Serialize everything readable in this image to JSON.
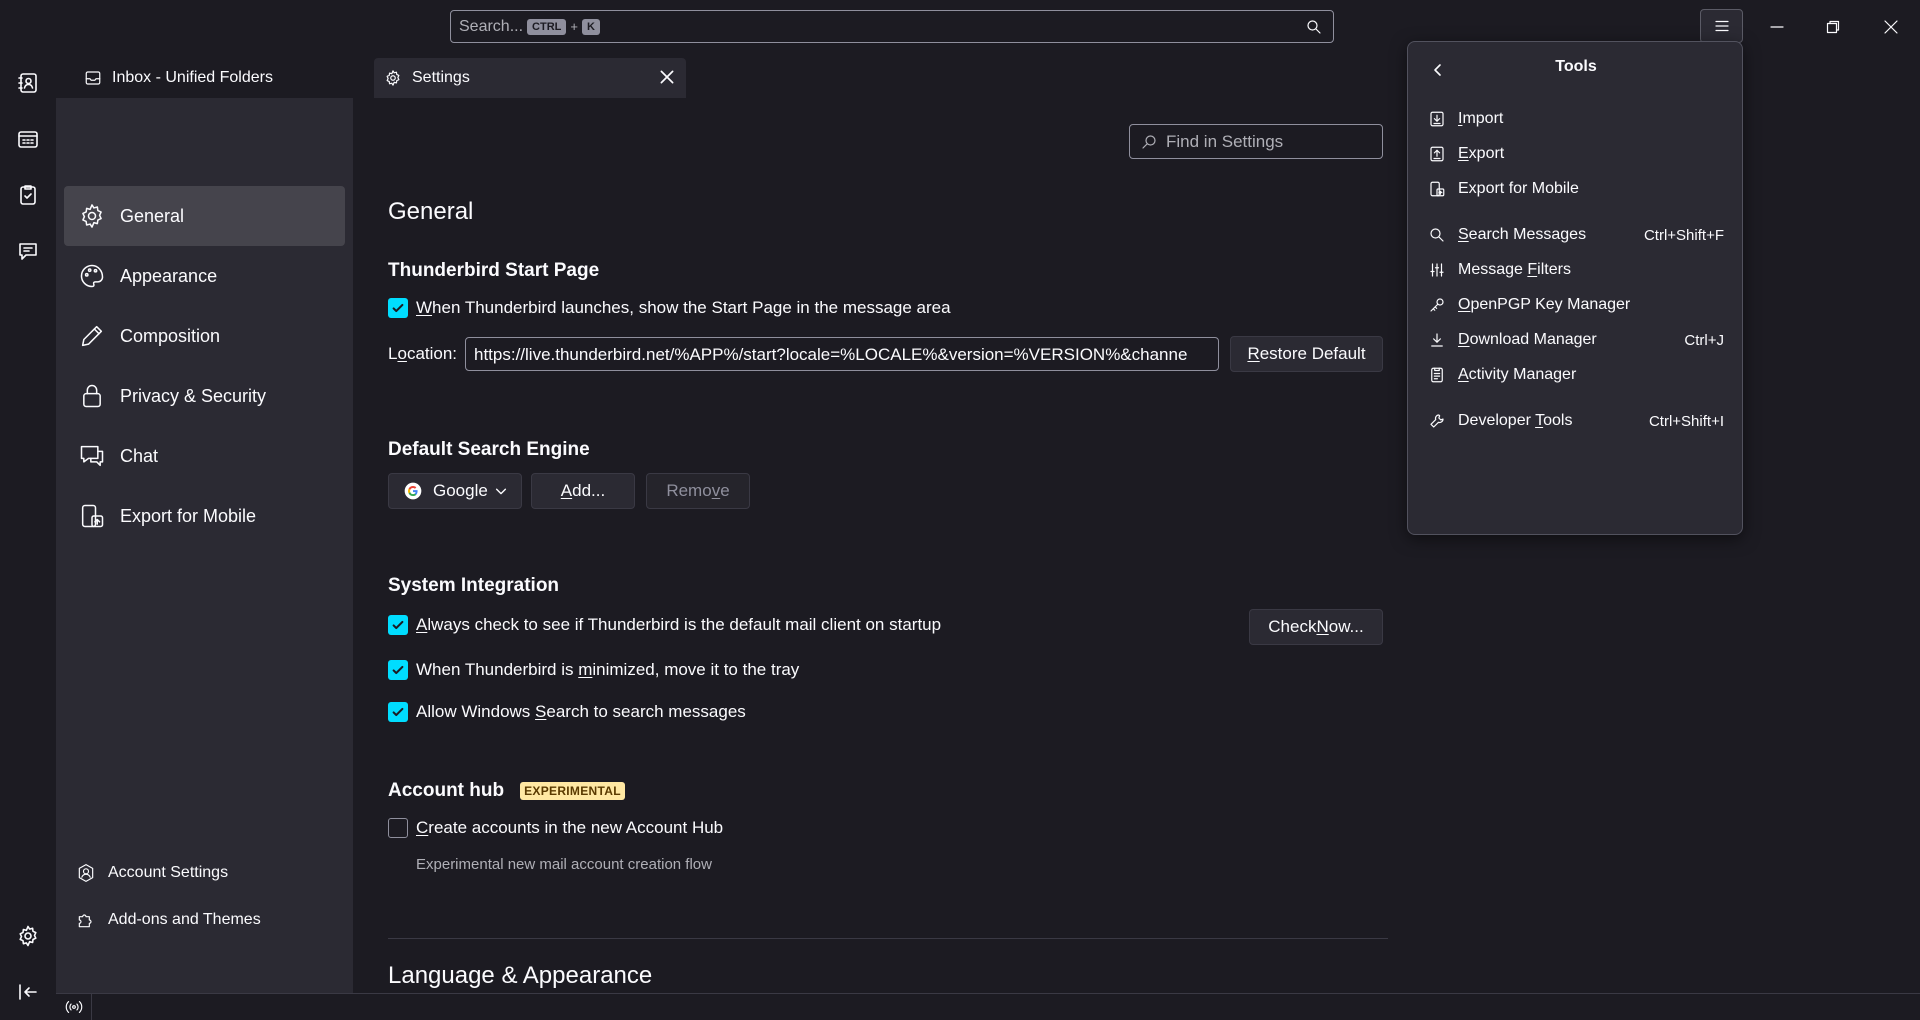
{
  "search": {
    "placeholder": "Search...",
    "kbd1": "CTRL",
    "plus": "+",
    "kbd2": "K"
  },
  "tabs": {
    "inbox": "Inbox - Unified Folders",
    "settings": "Settings"
  },
  "nav": {
    "items": [
      {
        "label": "General"
      },
      {
        "label": "Appearance"
      },
      {
        "label": "Composition"
      },
      {
        "label": "Privacy & Security"
      },
      {
        "label": "Chat"
      },
      {
        "label": "Export for Mobile"
      }
    ],
    "footer": [
      {
        "label": "Account Settings"
      },
      {
        "label": "Add-ons and Themes"
      }
    ]
  },
  "content": {
    "find_placeholder": "Find in Settings",
    "general_title": "General",
    "start_page": {
      "title": "Thunderbird Start Page",
      "checkbox_label_pre": "",
      "checkbox_label_u": "W",
      "checkbox_label_post": "hen Thunderbird launches, show the Start Page in the message area",
      "location_label_pre": "L",
      "location_label_u": "o",
      "location_label_post": "cation:",
      "location_value": "https://live.thunderbird.net/%APP%/start?locale=%LOCALE%&version=%VERSION%&channe",
      "restore_pre": "",
      "restore_u": "R",
      "restore_post": "estore Default"
    },
    "search_engine": {
      "title": "Default Search Engine",
      "selected": "Google",
      "add_pre": "",
      "add_u": "A",
      "add_post": "dd...",
      "remove_pre": "Remo",
      "remove_u": "v",
      "remove_post": "e"
    },
    "system": {
      "title": "System Integration",
      "check1_pre": "",
      "check1_u": "A",
      "check1_post": "lways check to see if Thunderbird is the default mail client on startup",
      "check_now_pre": "Check ",
      "check_now_u": "N",
      "check_now_post": "ow...",
      "check2_pre": "When Thunderbird is ",
      "check2_u": "m",
      "check2_post": "inimized, move it to the tray",
      "check3_pre": "Allow Windows ",
      "check3_u": "S",
      "check3_post": "earch to search messages"
    },
    "account_hub": {
      "title": "Account hub",
      "badge": "EXPERIMENTAL",
      "check_pre": "",
      "check_u": "C",
      "check_post": "reate accounts in the new Account Hub",
      "description": "Experimental new mail account creation flow"
    },
    "language_title": "Language & Appearance"
  },
  "tools": {
    "title": "Tools",
    "items": [
      {
        "pre": "",
        "u": "I",
        "post": "mport",
        "shortcut": ""
      },
      {
        "pre": "",
        "u": "E",
        "post": "xport",
        "shortcut": ""
      },
      {
        "pre": "Export for Mobile",
        "u": "",
        "post": "",
        "shortcut": ""
      },
      {
        "pre": "",
        "u": "S",
        "post": "earch Messages",
        "shortcut": "Ctrl+Shift+F"
      },
      {
        "pre": "Message ",
        "u": "F",
        "post": "ilters",
        "shortcut": ""
      },
      {
        "pre": "",
        "u": "O",
        "post": "penPGP Key Manager",
        "shortcut": ""
      },
      {
        "pre": "",
        "u": "D",
        "post": "ownload Manager",
        "shortcut": "Ctrl+J"
      },
      {
        "pre": "",
        "u": "A",
        "post": "ctivity Manager",
        "shortcut": ""
      },
      {
        "pre": "Developer ",
        "u": "T",
        "post": "ools",
        "shortcut": "Ctrl+Shift+I"
      }
    ]
  },
  "colors": {
    "accent": "#00ddff",
    "background": "#1c1b22",
    "panel": "#2b2a33"
  }
}
